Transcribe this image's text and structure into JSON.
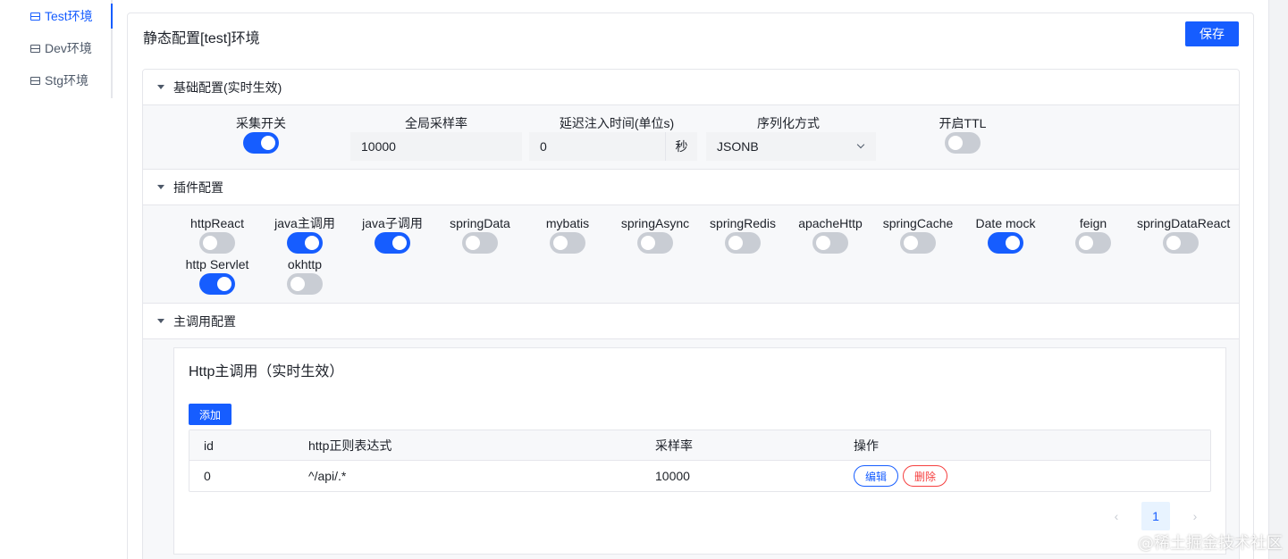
{
  "sidebar": {
    "items": [
      {
        "label": "Test环境",
        "active": true
      },
      {
        "label": "Dev环境",
        "active": false
      },
      {
        "label": "Stg环境",
        "active": false
      }
    ]
  },
  "page": {
    "title": "静态配置[test]环境",
    "save_label": "保存"
  },
  "basic": {
    "header": "基础配置(实时生效)",
    "collect_switch": {
      "label": "采集开关",
      "on": true
    },
    "sample_rate": {
      "label": "全局采样率",
      "value": "10000"
    },
    "delay": {
      "label": "延迟注入时间(单位s)",
      "value": "0",
      "suffix": "秒"
    },
    "serialize": {
      "label": "序列化方式",
      "value": "JSONB"
    },
    "ttl": {
      "label": "开启TTL",
      "on": false
    }
  },
  "plugins": {
    "header": "插件配置",
    "items": [
      {
        "label": "httpReact",
        "on": false
      },
      {
        "label": "java主调用",
        "on": true
      },
      {
        "label": "java子调用",
        "on": true
      },
      {
        "label": "springData",
        "on": false
      },
      {
        "label": "mybatis",
        "on": false
      },
      {
        "label": "springAsync",
        "on": false
      },
      {
        "label": "springRedis",
        "on": false
      },
      {
        "label": "apacheHttp",
        "on": false
      },
      {
        "label": "springCache",
        "on": false
      },
      {
        "label": "Date mock",
        "on": true
      },
      {
        "label": "feign",
        "on": false
      },
      {
        "label": "springDataReact",
        "on": false
      },
      {
        "label": "http Servlet",
        "on": true
      },
      {
        "label": "okhttp",
        "on": false
      }
    ]
  },
  "main_call": {
    "header": "主调用配置",
    "card_title": "Http主调用（实时生效）",
    "add_label": "添加",
    "columns": [
      "id",
      "http正则表达式",
      "采样率",
      "操作"
    ],
    "rows": [
      {
        "id": "0",
        "regex": "^/api/.*",
        "rate": "10000",
        "edit": "编辑",
        "delete": "删除"
      }
    ],
    "pagination": {
      "prev": "‹",
      "current": "1",
      "next": "›"
    }
  },
  "watermark": "@稀土掘金技术社区",
  "colors": {
    "primary": "#165dff",
    "danger": "#f53f3f",
    "switch_off": "#c9cdd4"
  }
}
